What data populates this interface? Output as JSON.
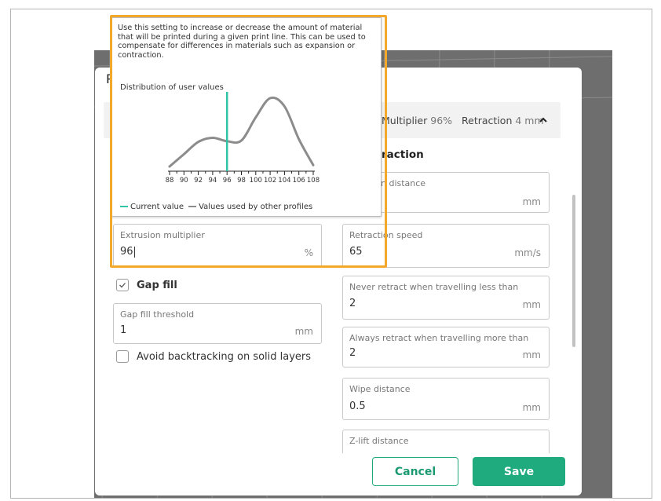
{
  "dialog": {
    "title_fragment": "P",
    "summary": {
      "multiplier_label": "Multiplier",
      "multiplier_value": "96%",
      "retraction_label": "Retraction",
      "retraction_value": "4 mm"
    },
    "retraction_heading": "raction",
    "retraction_distance": {
      "label": "n distance",
      "unit": "mm"
    },
    "extrusion_multiplier": {
      "label": "Extrusion multiplier",
      "value": "96",
      "unit": "%"
    },
    "retraction_speed": {
      "label": "Retraction speed",
      "value": "65",
      "unit": "mm/s"
    },
    "gap_fill": {
      "label": "Gap fill",
      "checked": true
    },
    "gap_fill_threshold": {
      "label": "Gap fill threshold",
      "value": "1",
      "unit": "mm"
    },
    "avoid_backtracking": {
      "label": "Avoid backtracking on solid layers",
      "checked": false
    },
    "never_retract": {
      "label": "Never retract when travelling less than",
      "value": "2",
      "unit": "mm"
    },
    "always_retract": {
      "label": "Always retract when travelling more than",
      "value": "2",
      "unit": "mm"
    },
    "wipe_distance": {
      "label": "Wipe distance",
      "value": "0.5",
      "unit": "mm"
    },
    "z_lift": {
      "label": "Z-lift distance"
    },
    "buttons": {
      "cancel": "Cancel",
      "save": "Save"
    }
  },
  "tooltip": {
    "description": "Use this setting to increase or decrease the amount of material that will be printed during a given print line. This can be used to compensate for differences in materials such as expansion or contraction.",
    "distribution_title": "Distribution of user values",
    "legend": {
      "current": "Current value",
      "others": "Values used by other profiles"
    }
  },
  "colors": {
    "accent": "#1fab7e",
    "highlight": "#f2a92b",
    "current_value_line": "#2ec4a5",
    "distribution_curve": "#8c8c8c"
  },
  "chart_data": {
    "type": "line",
    "title": "Distribution of user values",
    "x_ticks": [
      "88",
      "90",
      "92",
      "94",
      "96",
      "98",
      "100",
      "102",
      "104",
      "106",
      "108"
    ],
    "xlim": [
      88,
      108
    ],
    "current_value": 96,
    "series": [
      {
        "name": "Values used by other profiles",
        "x": [
          88,
          90,
          92,
          94,
          96,
          98,
          100,
          102,
          104,
          106,
          108
        ],
        "y": [
          0.0,
          0.18,
          0.36,
          0.42,
          0.37,
          0.38,
          0.72,
          1.0,
          0.88,
          0.4,
          0.02
        ]
      }
    ],
    "legend": [
      "Current value",
      "Values used by other profiles"
    ]
  }
}
